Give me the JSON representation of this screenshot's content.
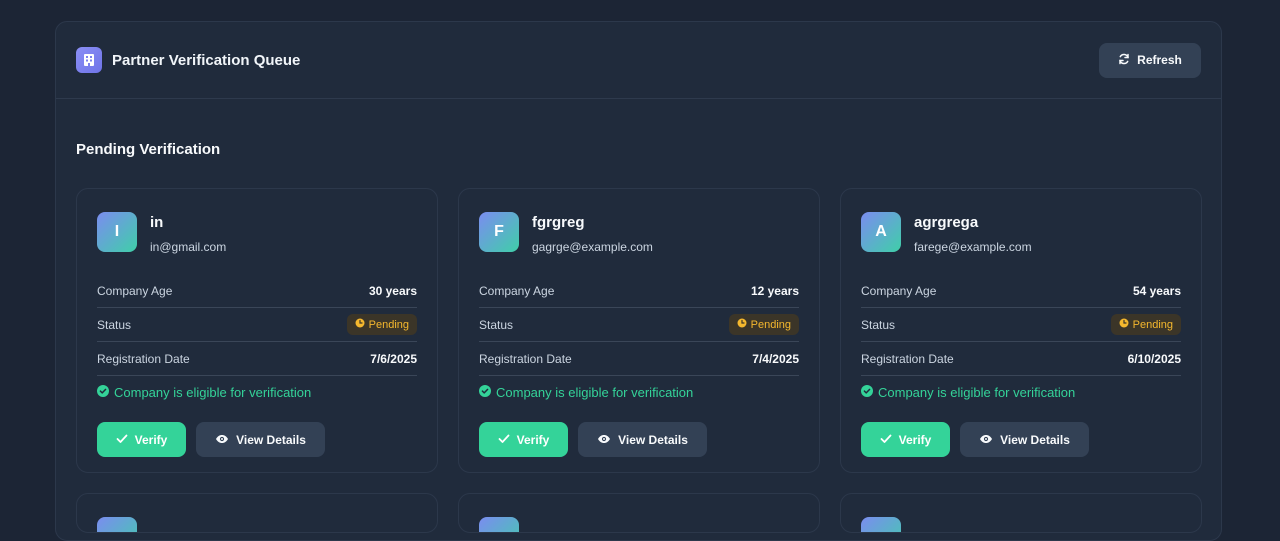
{
  "header": {
    "title": "Partner Verification Queue",
    "refresh_label": "Refresh"
  },
  "section": {
    "title": "Pending Verification"
  },
  "labels": {
    "company_age": "Company Age",
    "status": "Status",
    "registration_date": "Registration Date",
    "eligible": "Company is eligible for verification",
    "verify": "Verify",
    "view_details": "View Details"
  },
  "partners": [
    {
      "initial": "I",
      "name": "in",
      "email": "in@gmail.com",
      "company_age": "30 years",
      "status": "Pending",
      "registration_date": "7/6/2025"
    },
    {
      "initial": "F",
      "name": "fgrgreg",
      "email": "gagrge@example.com",
      "company_age": "12 years",
      "status": "Pending",
      "registration_date": "7/4/2025"
    },
    {
      "initial": "A",
      "name": "agrgrega",
      "email": "farege@example.com",
      "company_age": "54 years",
      "status": "Pending",
      "registration_date": "6/10/2025"
    }
  ],
  "colors": {
    "accent_green": "#34d399",
    "pending_amber": "#f5b82e",
    "panel_bg": "#202b3c",
    "page_bg": "#1c2535"
  },
  "icons": {
    "title": "building-icon",
    "refresh": "refresh-icon",
    "status": "clock-icon",
    "eligible": "check-circle-icon",
    "verify": "check-icon",
    "details": "eye-icon"
  }
}
